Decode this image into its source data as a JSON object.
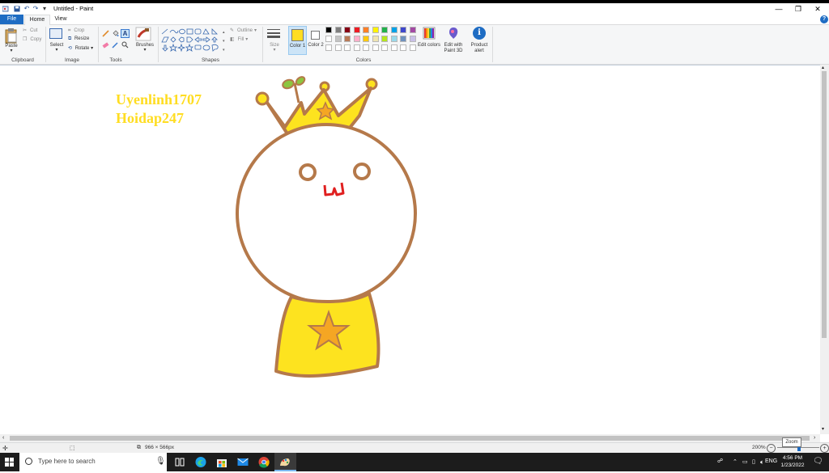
{
  "window": {
    "title": "Untitled - Paint"
  },
  "tabs": [
    {
      "label": "File"
    },
    {
      "label": "Home"
    },
    {
      "label": "View"
    }
  ],
  "ribbon": {
    "clipboard": {
      "group": "Clipboard",
      "paste": "Paste",
      "cut": "Cut",
      "copy": "Copy"
    },
    "image": {
      "group": "Image",
      "select": "Select",
      "crop": "Crop",
      "resize": "Resize",
      "rotate": "Rotate"
    },
    "tools": {
      "group": "Tools"
    },
    "brushes": {
      "label": "Brushes"
    },
    "shapes": {
      "group": "Shapes",
      "outline": "Outline",
      "fill": "Fill"
    },
    "size": {
      "label": "Size"
    },
    "colors": {
      "group": "Colors",
      "color1": "Color 1",
      "color2": "Color 2",
      "edit_colors": "Edit colors",
      "edit_paint3d": "Edit with Paint 3D",
      "product_alert": "Product alert",
      "color1_value": "#ffdd22",
      "color2_value": "#ffffff",
      "palette_row1": [
        "#000000",
        "#7f7f7f",
        "#880015",
        "#ed1c24",
        "#ff7f27",
        "#fff200",
        "#22b14c",
        "#00a2e8",
        "#3f48cc",
        "#a349a4"
      ],
      "palette_row2": [
        "#ffffff",
        "#c3c3c3",
        "#b97a57",
        "#ffaec9",
        "#ffc90e",
        "#efe4b0",
        "#b5e61d",
        "#99d9ea",
        "#7092be",
        "#c8bfe7"
      ]
    }
  },
  "drawing": {
    "text_line1": "Uyenlinh1707",
    "text_line2": "Hoidap247",
    "stroke_color": "#b5794a",
    "fill_yellow": "#fde31f",
    "star_color": "#f5a623",
    "mouth_color": "#e02020",
    "leaf_color": "#8cc63f"
  },
  "status": {
    "dimensions": "966 × 566px",
    "zoom": "200%",
    "zoom_tooltip": "Zoom"
  },
  "taskbar": {
    "search_placeholder": "Type here to search",
    "lang": "ENG",
    "time": "4:56 PM",
    "date": "1/23/2022"
  }
}
